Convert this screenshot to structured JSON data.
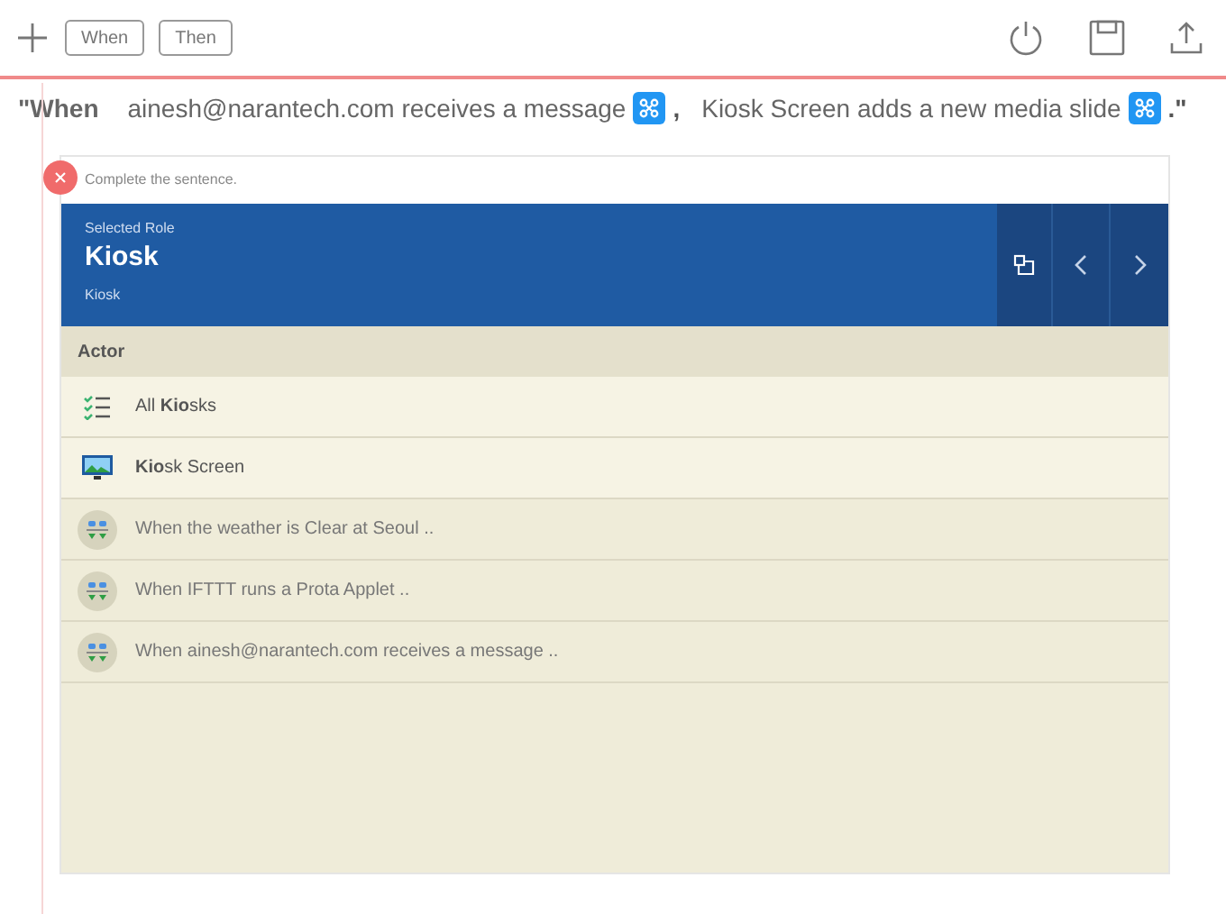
{
  "toolbar": {
    "tabs": [
      {
        "label": "When"
      },
      {
        "label": "Then"
      }
    ]
  },
  "sentence": {
    "lead": "\"When",
    "parts": [
      {
        "text": "ainesh@narantech.com receives a message",
        "sep": ","
      },
      {
        "text": "Kiosk Screen adds a new media slide",
        "sep": ".\""
      }
    ]
  },
  "panel": {
    "prompt": "Complete the sentence.",
    "role_caption": "Selected Role",
    "role": "Kiosk",
    "role_sub": "Kiosk",
    "section": "Actor",
    "items": [
      {
        "kind": "group",
        "label": "All **Kio**sks"
      },
      {
        "kind": "screen",
        "label": "**Kio**sk Screen"
      },
      {
        "kind": "suggestion",
        "label": "When the weather is Clear at Seoul .."
      },
      {
        "kind": "suggestion",
        "label": "When IFTTT runs a Prota Applet .."
      },
      {
        "kind": "suggestion",
        "label": "When ainesh@narantech.com receives a message .."
      }
    ]
  }
}
